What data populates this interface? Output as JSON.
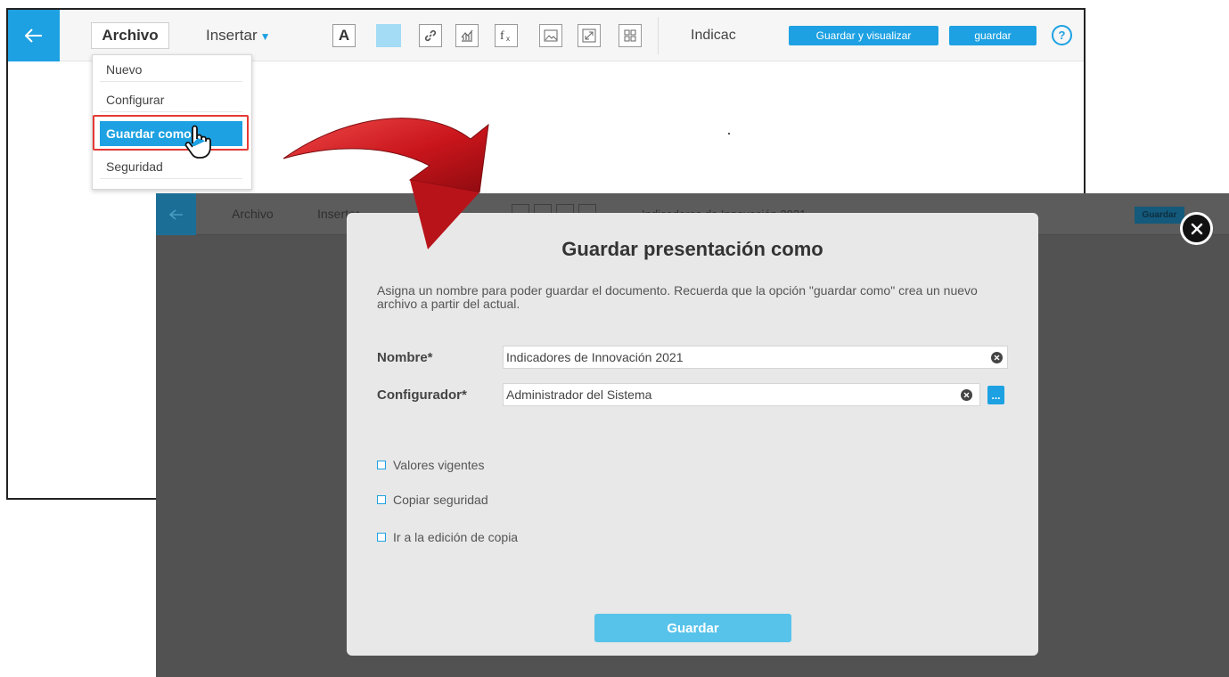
{
  "editor": {
    "menu_archivo": "Archivo",
    "menu_insertar": "Insertar",
    "title_truncated": "Indicac",
    "btn_save_view": "Guardar y visualizar",
    "btn_save": "guardar",
    "help_label": "?",
    "file_menu_items": [
      "Nuevo",
      "Configurar",
      "Guardar como",
      "Seguridad"
    ],
    "highlighted_item": "Guardar como",
    "highlight_color": "#1da1e2",
    "callout_color": "#e53935"
  },
  "background_editor": {
    "menu_archivo": "Archivo",
    "menu_insertar": "Insertar",
    "doc_title": "Indicadores de Innovación 2021",
    "btn_save": "Guardar"
  },
  "dialog": {
    "title": "Guardar presentación como",
    "description": "Asigna un nombre para poder guardar el documento. Recuerda que la opción \"guardar como\" crea un nuevo archivo a partir del actual.",
    "nombre_label": "Nombre*",
    "nombre_value": "Indicadores de Innovación 2021",
    "configurador_label": "Configurador*",
    "configurador_value": "Administrador del Sistema",
    "browse_label": "...",
    "checkboxes": [
      {
        "label": "Valores vigentes",
        "checked": false
      },
      {
        "label": "Copiar seguridad",
        "checked": false
      },
      {
        "label": "Ir a la edición de copia",
        "checked": false
      }
    ],
    "save_button": "Guardar"
  },
  "icons": [
    "back-arrow-icon",
    "link-icon",
    "chart-icon",
    "function-icon",
    "image-icon",
    "expand-icon",
    "widget-icon",
    "help-icon",
    "hand-cursor-icon",
    "clear-icon",
    "close-icon"
  ],
  "colors": {
    "accent": "#1da1e2",
    "overlay": "#525252",
    "dialog_bg": "#e8e8e8",
    "save_button": "#57c3ea",
    "arrow": "#c8151b"
  }
}
